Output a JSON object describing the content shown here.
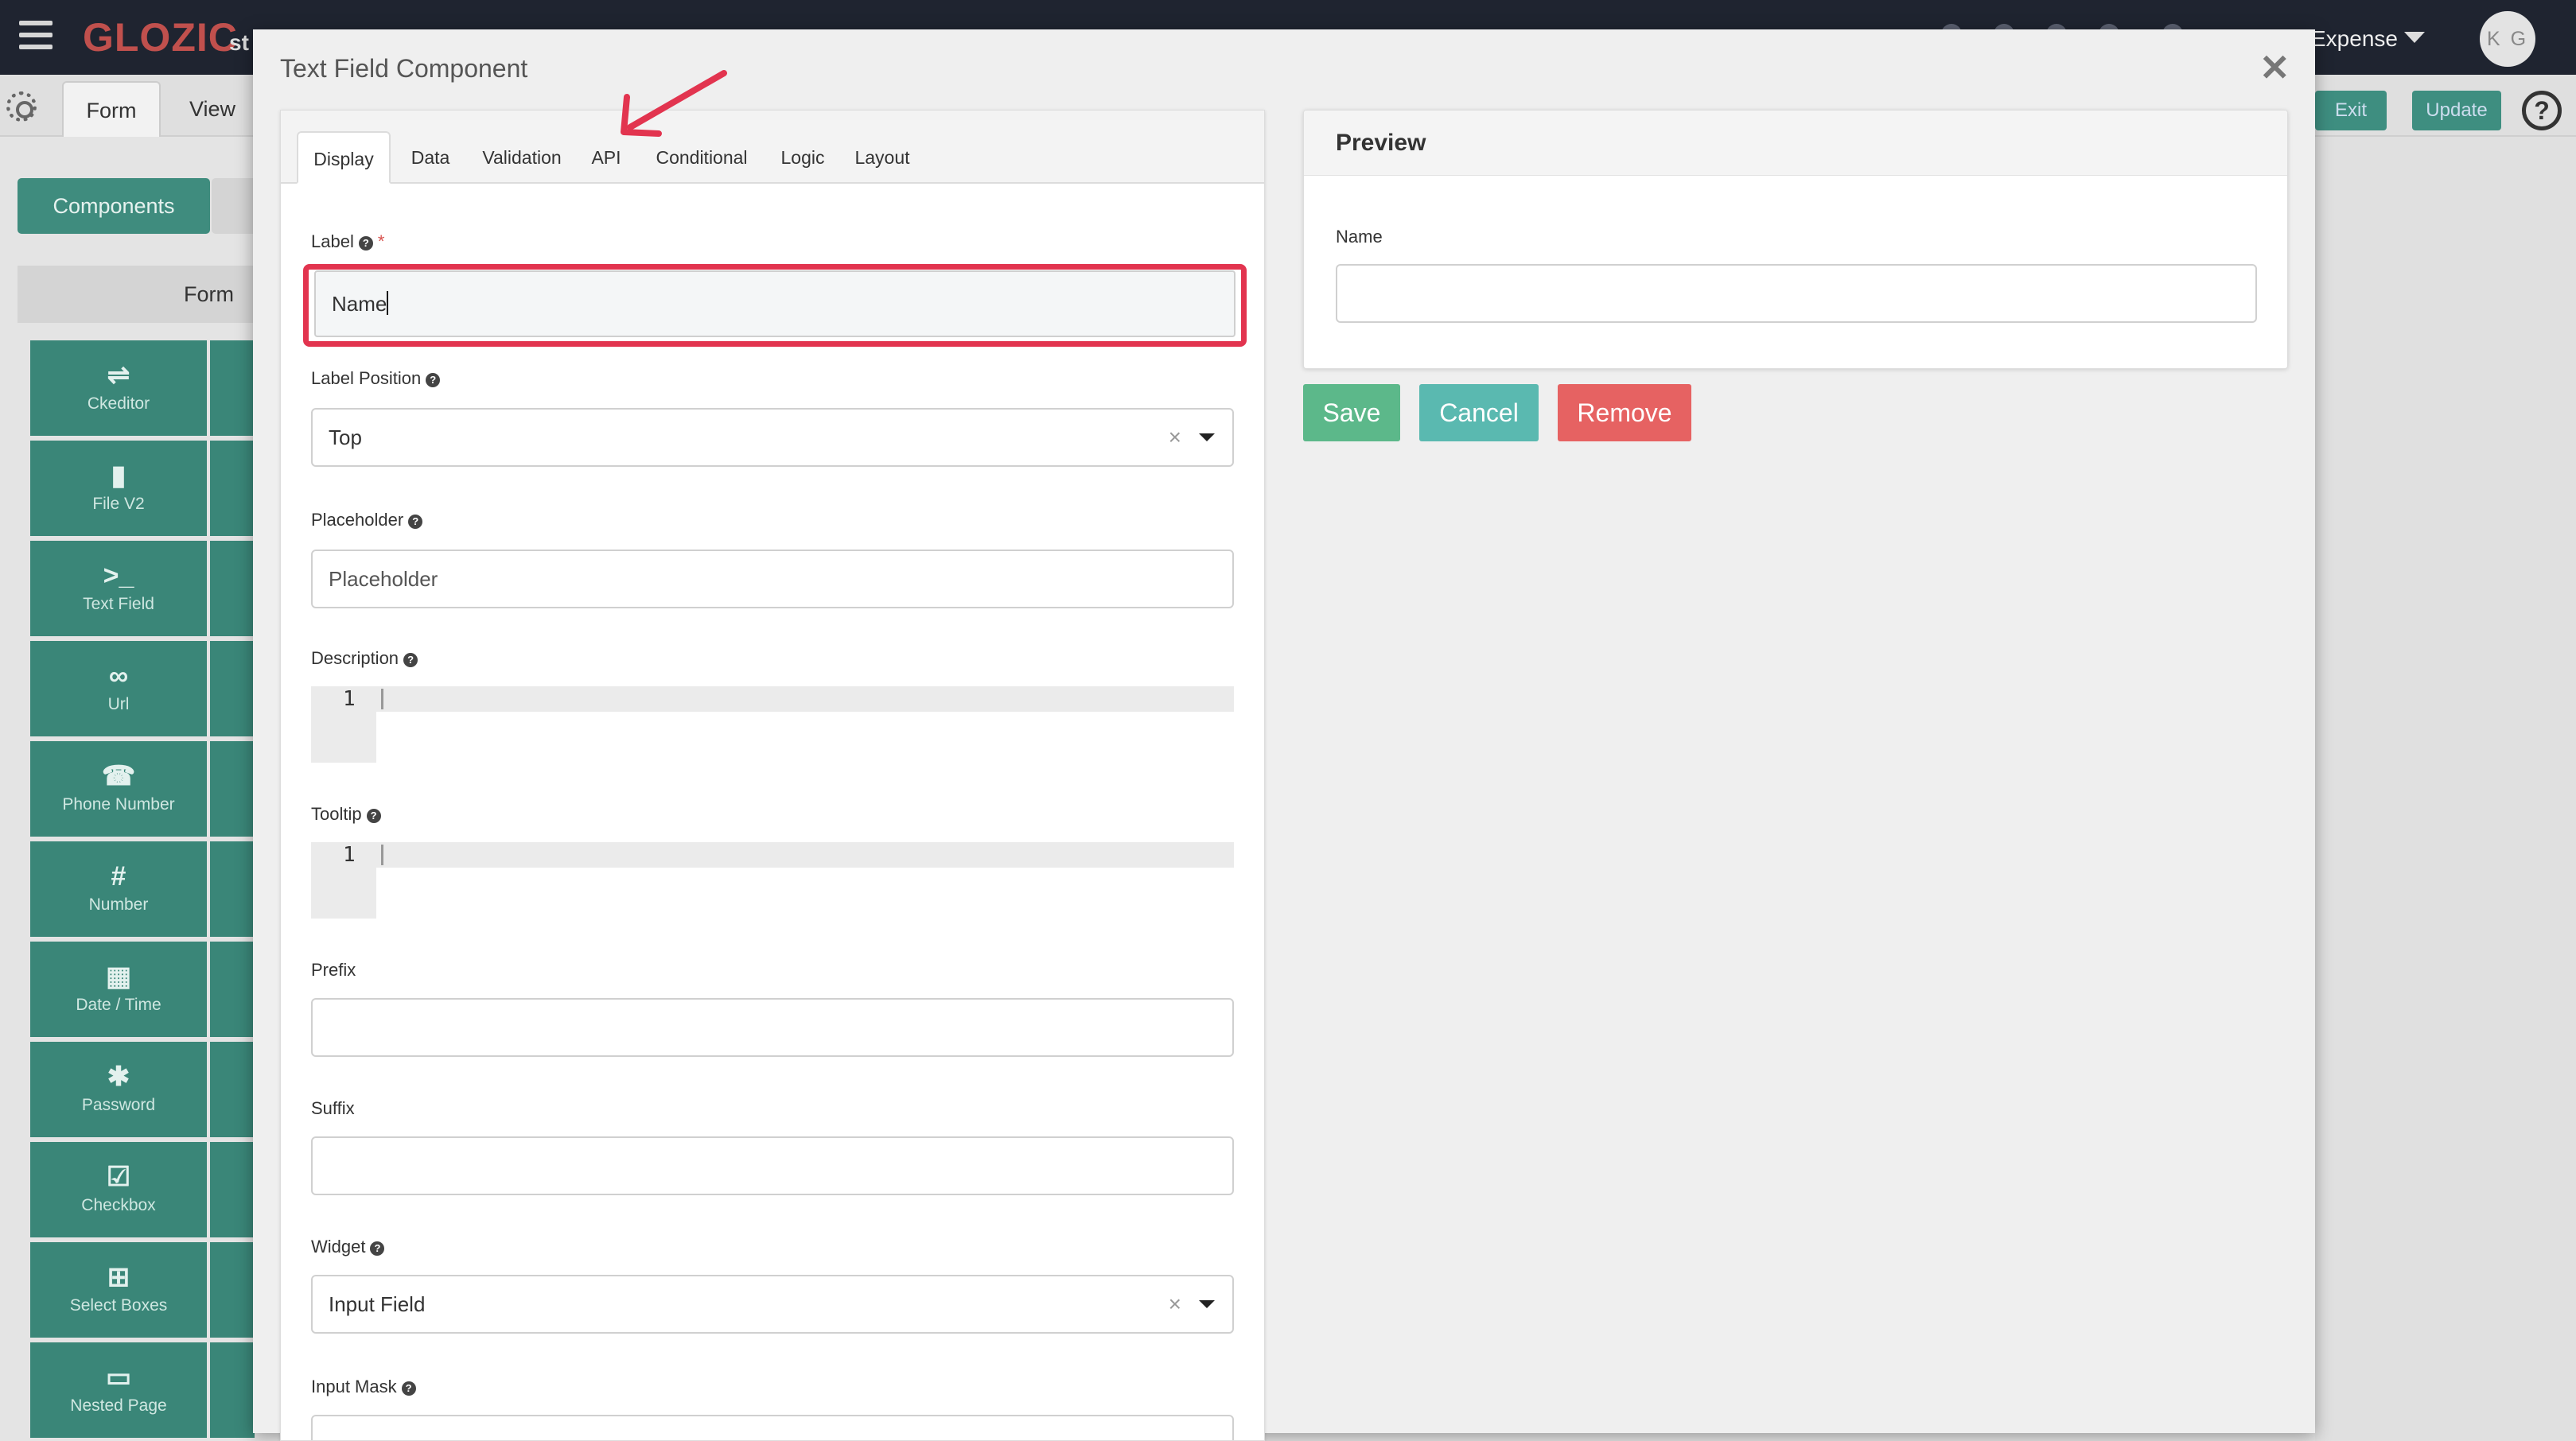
{
  "app": {
    "logo": "GLOZIC",
    "logo_sub": "st",
    "app_name": "Expense",
    "avatar_initials": "K G"
  },
  "builder": {
    "tabs": [
      {
        "label": "Form",
        "active": true
      },
      {
        "label": "View",
        "active": false
      }
    ],
    "exit_label": "Exit",
    "update_label": "Update",
    "components_label": "Components",
    "section_label": "Form",
    "palette": [
      {
        "label": "Ckeditor",
        "icon": "signpost-icon"
      },
      {
        "label": "File V2",
        "icon": "file-icon"
      },
      {
        "label": "Text Field",
        "icon": "terminal-icon"
      },
      {
        "label": "Url",
        "icon": "link-icon"
      },
      {
        "label": "Phone Number",
        "icon": "phone-icon"
      },
      {
        "label": "Number",
        "icon": "hash-icon"
      },
      {
        "label": "Date / Time",
        "icon": "calendar-icon"
      },
      {
        "label": "Password",
        "icon": "asterisk-icon"
      },
      {
        "label": "Checkbox",
        "icon": "checkbox-icon"
      },
      {
        "label": "Select Boxes",
        "icon": "plus-square-icon"
      },
      {
        "label": "Nested Page",
        "icon": "card-icon"
      }
    ]
  },
  "modal": {
    "title": "Text Field Component",
    "close_glyph": "✕",
    "tabs": [
      {
        "label": "Display",
        "active": true
      },
      {
        "label": "Data",
        "active": false
      },
      {
        "label": "Validation",
        "active": false
      },
      {
        "label": "API",
        "active": false
      },
      {
        "label": "Conditional",
        "active": false
      },
      {
        "label": "Logic",
        "active": false
      },
      {
        "label": "Layout",
        "active": false
      }
    ],
    "fields": {
      "label": {
        "label": "Label",
        "value": "Name",
        "required": "*"
      },
      "label_position": {
        "label": "Label Position",
        "value": "Top"
      },
      "placeholder": {
        "label": "Placeholder",
        "placeholder": "Placeholder"
      },
      "description": {
        "label": "Description",
        "line": "1"
      },
      "tooltip": {
        "label": "Tooltip",
        "line": "1"
      },
      "prefix": {
        "label": "Prefix",
        "value": ""
      },
      "suffix": {
        "label": "Suffix",
        "value": ""
      },
      "widget": {
        "label": "Widget",
        "value": "Input Field"
      },
      "input_mask": {
        "label": "Input Mask"
      }
    },
    "preview": {
      "title": "Preview",
      "field_label": "Name"
    },
    "buttons": {
      "save": "Save",
      "cancel": "Cancel",
      "remove": "Remove"
    }
  },
  "colors": {
    "highlight": "#e2344f",
    "palette_bg": "#3a8678",
    "save": "#5cb88a",
    "cancel": "#5ab9b0",
    "remove": "#e66262"
  }
}
